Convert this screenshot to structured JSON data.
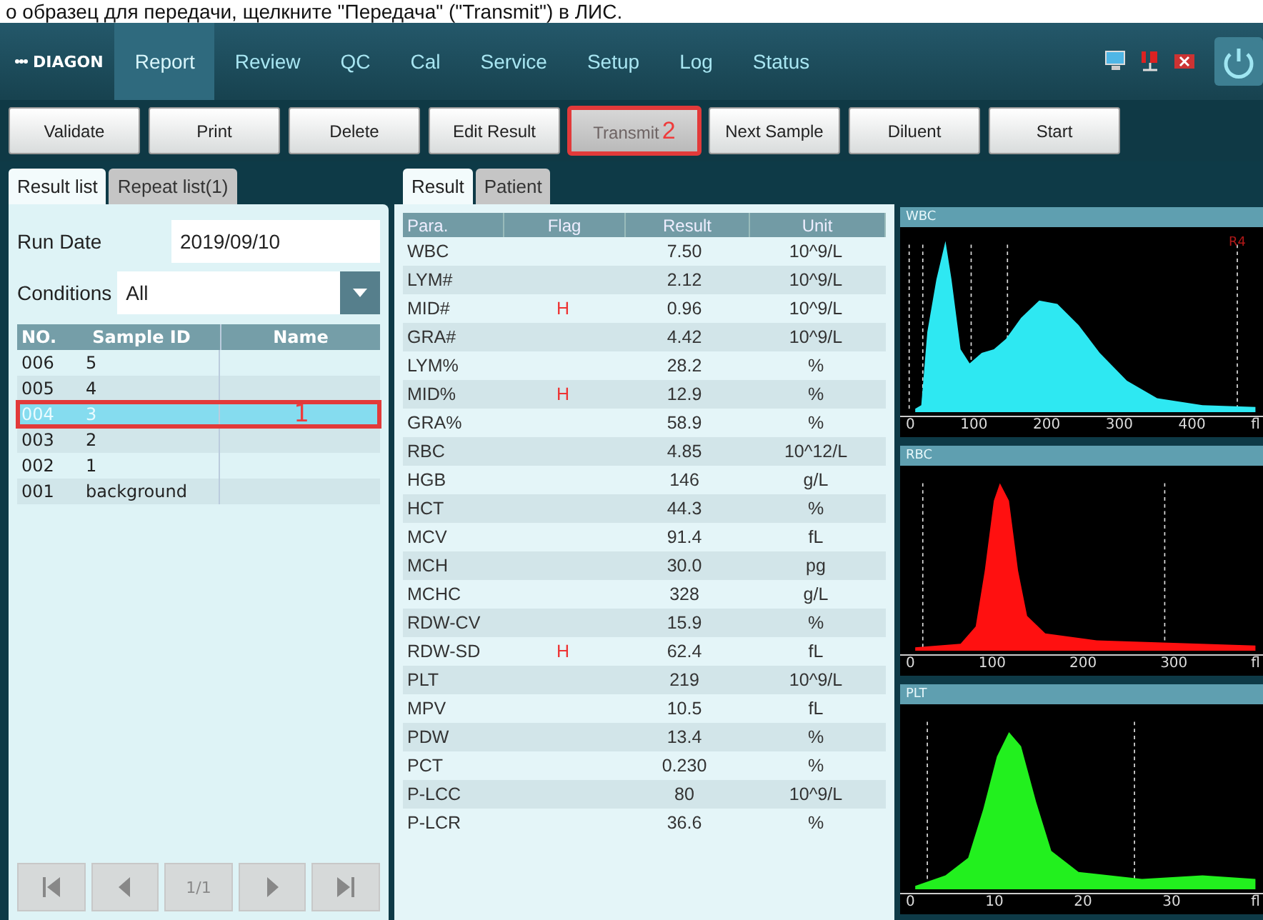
{
  "caption": "о образец для передачи, щелкните \"Передача\" (\"Transmit\") в ЛИС.",
  "app": {
    "logo": "DIAGON"
  },
  "nav": [
    {
      "label": "Report",
      "selected": true
    },
    {
      "label": "Review",
      "selected": false
    },
    {
      "label": "QC",
      "selected": false
    },
    {
      "label": "Cal",
      "selected": false
    },
    {
      "label": "Service",
      "selected": false
    },
    {
      "label": "Setup",
      "selected": false
    },
    {
      "label": "Log",
      "selected": false
    },
    {
      "label": "Status",
      "selected": false
    }
  ],
  "toolbar": [
    {
      "label": "Validate",
      "disabled": false
    },
    {
      "label": "Print",
      "disabled": false
    },
    {
      "label": "Delete",
      "disabled": false
    },
    {
      "label": "Edit Result",
      "disabled": false
    },
    {
      "label": "Transmit",
      "disabled": true,
      "marker": "2"
    },
    {
      "label": "Next Sample",
      "disabled": false
    },
    {
      "label": "Diluent",
      "disabled": false
    },
    {
      "label": "Start",
      "disabled": false
    }
  ],
  "list_tabs": [
    {
      "label": "Result list",
      "selected": true
    },
    {
      "label": "Repeat list(1)",
      "selected": false
    }
  ],
  "run_date": {
    "label": "Run Date",
    "value": "2019/09/10"
  },
  "conditions": {
    "label": "Conditions",
    "value": "All"
  },
  "sample_table": {
    "columns": [
      "NO.",
      "Sample ID",
      "Name"
    ],
    "rows": [
      {
        "no": "006",
        "sample_id": "5",
        "selected": false
      },
      {
        "no": "005",
        "sample_id": "4",
        "selected": false
      },
      {
        "no": "004",
        "sample_id": "3",
        "selected": true,
        "marker": "1"
      },
      {
        "no": "003",
        "sample_id": "2",
        "selected": false
      },
      {
        "no": "002",
        "sample_id": "1",
        "selected": false
      },
      {
        "no": "001",
        "sample_id": "background",
        "selected": false
      }
    ]
  },
  "pager": {
    "page": "1/1"
  },
  "result_tabs": [
    {
      "label": "Result",
      "selected": true
    },
    {
      "label": "Patient",
      "selected": false
    }
  ],
  "result_table": {
    "columns": [
      "Para.",
      "Flag",
      "Result",
      "Unit"
    ],
    "rows": [
      {
        "para": "WBC",
        "result": "7.50",
        "unit": "10^9/L"
      },
      {
        "para": "LYM#",
        "result": "2.12",
        "unit": "10^9/L"
      },
      {
        "para": "MID#",
        "flag": "H",
        "result": "0.96",
        "unit": "10^9/L"
      },
      {
        "para": "GRA#",
        "result": "4.42",
        "unit": "10^9/L"
      },
      {
        "para": "LYM%",
        "result": "28.2",
        "unit": "%"
      },
      {
        "para": "MID%",
        "flag": "H",
        "result": "12.9",
        "unit": "%"
      },
      {
        "para": "GRA%",
        "result": "58.9",
        "unit": "%"
      },
      {
        "para": "RBC",
        "result": "4.85",
        "unit": "10^12/L"
      },
      {
        "para": "HGB",
        "result": "146",
        "unit": "g/L"
      },
      {
        "para": "HCT",
        "result": "44.3",
        "unit": "%"
      },
      {
        "para": "MCV",
        "result": "91.4",
        "unit": "fL"
      },
      {
        "para": "MCH",
        "result": "30.0",
        "unit": "pg"
      },
      {
        "para": "MCHC",
        "result": "328",
        "unit": "g/L"
      },
      {
        "para": "RDW-CV",
        "result": "15.9",
        "unit": "%"
      },
      {
        "para": "RDW-SD",
        "flag": "H",
        "result": "62.4",
        "unit": "fL"
      },
      {
        "para": "PLT",
        "result": "219",
        "unit": "10^9/L"
      },
      {
        "para": "MPV",
        "result": "10.5",
        "unit": "fL"
      },
      {
        "para": "PDW",
        "result": "13.4",
        "unit": "%"
      },
      {
        "para": "PCT",
        "result": "0.230",
        "unit": "%"
      },
      {
        "para": "P-LCC",
        "result": "80",
        "unit": "10^9/L"
      },
      {
        "para": "P-LCR",
        "result": "36.6",
        "unit": "%"
      }
    ]
  },
  "histograms": [
    {
      "kind": "wbc",
      "title": "WBC",
      "color": "#2ee8f2",
      "mark": "R4",
      "ticks": [
        "0",
        "100",
        "200",
        "300",
        "400"
      ],
      "unit": "fl"
    },
    {
      "kind": "rbc",
      "title": "RBC",
      "color": "#ff1010",
      "ticks": [
        "0",
        "100",
        "200",
        "300"
      ],
      "unit": "fl"
    },
    {
      "kind": "plt",
      "title": "PLT",
      "color": "#22f01e",
      "ticks": [
        "0",
        "10",
        "20",
        "30"
      ],
      "unit": "fl"
    }
  ]
}
